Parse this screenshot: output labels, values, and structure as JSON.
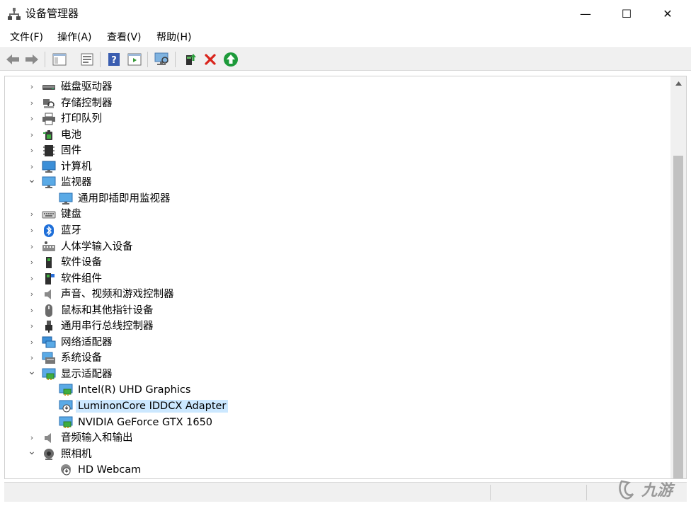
{
  "window": {
    "title": "设备管理器",
    "controls": {
      "minimize": "—",
      "maximize": "☐",
      "close": "✕"
    }
  },
  "menu": [
    "文件(F)",
    "操作(A)",
    "查看(V)",
    "帮助(H)"
  ],
  "toolbar": [
    {
      "name": "back-icon"
    },
    {
      "name": "forward-icon"
    },
    {
      "name": "show-hide-console-tree-icon"
    },
    {
      "name": "properties-icon"
    },
    {
      "name": "help-icon"
    },
    {
      "name": "action-pane-icon"
    },
    {
      "name": "scan-hardware-icon"
    },
    {
      "name": "update-driver-icon"
    },
    {
      "name": "uninstall-device-icon"
    },
    {
      "name": "enable-device-icon"
    }
  ],
  "tree": [
    {
      "label": "磁盘驱动器",
      "level": 0,
      "expanded": false,
      "icon": "disk-drive-icon"
    },
    {
      "label": "存储控制器",
      "level": 0,
      "expanded": false,
      "icon": "storage-controller-icon"
    },
    {
      "label": "打印队列",
      "level": 0,
      "expanded": false,
      "icon": "printer-icon"
    },
    {
      "label": "电池",
      "level": 0,
      "expanded": false,
      "icon": "battery-icon"
    },
    {
      "label": "固件",
      "level": 0,
      "expanded": false,
      "icon": "firmware-icon"
    },
    {
      "label": "计算机",
      "level": 0,
      "expanded": false,
      "icon": "computer-icon"
    },
    {
      "label": "监视器",
      "level": 0,
      "expanded": true,
      "icon": "monitor-icon"
    },
    {
      "label": "通用即插即用监视器",
      "level": 1,
      "icon": "monitor-icon"
    },
    {
      "label": "键盘",
      "level": 0,
      "expanded": false,
      "icon": "keyboard-icon"
    },
    {
      "label": "蓝牙",
      "level": 0,
      "expanded": false,
      "icon": "bluetooth-icon"
    },
    {
      "label": "人体学输入设备",
      "level": 0,
      "expanded": false,
      "icon": "hid-icon"
    },
    {
      "label": "软件设备",
      "level": 0,
      "expanded": false,
      "icon": "software-device-icon"
    },
    {
      "label": "软件组件",
      "level": 0,
      "expanded": false,
      "icon": "software-component-icon"
    },
    {
      "label": "声音、视频和游戏控制器",
      "level": 0,
      "expanded": false,
      "icon": "sound-icon"
    },
    {
      "label": "鼠标和其他指针设备",
      "level": 0,
      "expanded": false,
      "icon": "mouse-icon"
    },
    {
      "label": "通用串行总线控制器",
      "level": 0,
      "expanded": false,
      "icon": "usb-icon"
    },
    {
      "label": "网络适配器",
      "level": 0,
      "expanded": false,
      "icon": "network-adapter-icon"
    },
    {
      "label": "系统设备",
      "level": 0,
      "expanded": false,
      "icon": "system-device-icon"
    },
    {
      "label": "显示适配器",
      "level": 0,
      "expanded": true,
      "icon": "display-adapter-icon"
    },
    {
      "label": "Intel(R) UHD Graphics",
      "level": 1,
      "icon": "display-adapter-icon"
    },
    {
      "label": "LuminonCore IDDCX Adapter",
      "level": 1,
      "icon": "display-adapter-warning-icon",
      "selected": true
    },
    {
      "label": "NVIDIA GeForce GTX 1650",
      "level": 1,
      "icon": "display-adapter-icon"
    },
    {
      "label": "音频输入和输出",
      "level": 0,
      "expanded": false,
      "icon": "audio-io-icon"
    },
    {
      "label": "照相机",
      "level": 0,
      "expanded": true,
      "icon": "camera-icon"
    },
    {
      "label": "HD Webcam",
      "level": 1,
      "icon": "webcam-icon"
    }
  ],
  "watermark": "九游"
}
